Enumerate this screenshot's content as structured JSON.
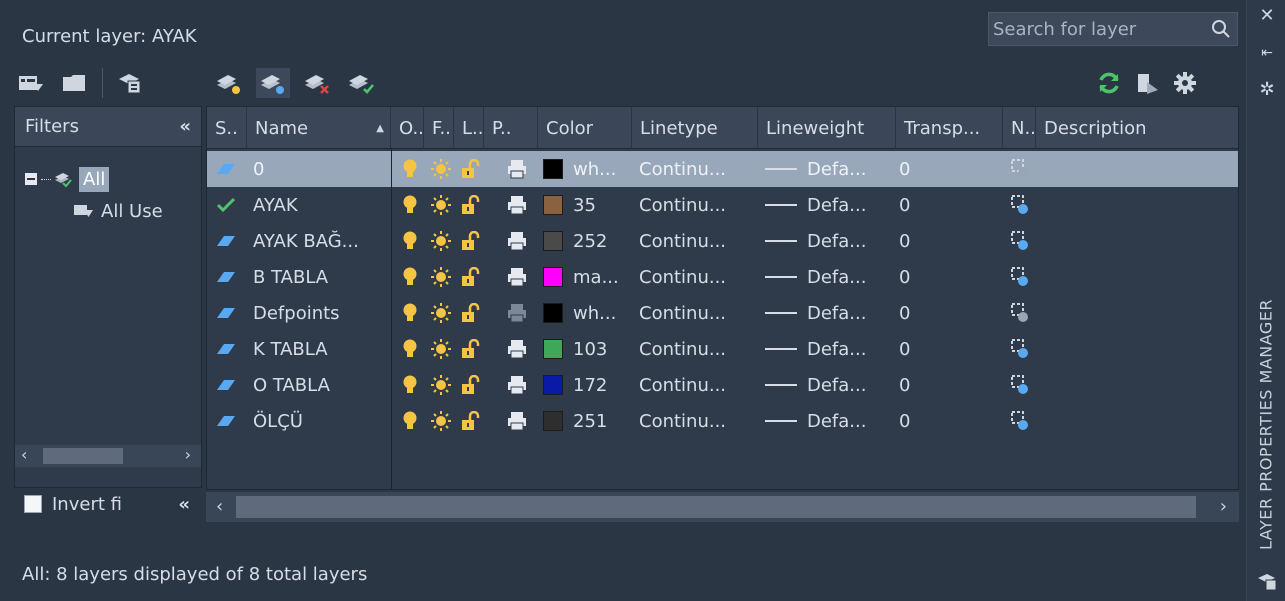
{
  "window": {
    "side_title": "LAYER PROPERTIES MANAGER"
  },
  "current_layer": "Current layer: AYAK",
  "search": {
    "placeholder": "Search for layer"
  },
  "filters": {
    "header": "Filters",
    "collapse": "«",
    "tree": [
      {
        "label": "All"
      },
      {
        "label": "All Use"
      }
    ],
    "invert_label": "Invert fi"
  },
  "columns": [
    "S..",
    "Name",
    "O..",
    "F..",
    "L..",
    "P..",
    "Color",
    "Linetype",
    "Lineweight",
    "Transp...",
    "N..",
    "Description"
  ],
  "layers": [
    {
      "status": "layer",
      "name": "0",
      "color_swatch": "#000000",
      "color_name": "wh...",
      "linetype": "Continu...",
      "lineweight": "Defa...",
      "transparency": "0",
      "plot_dim": false,
      "selected": true
    },
    {
      "status": "current",
      "name": "AYAK",
      "color_swatch": "#8a6240",
      "color_name": "35",
      "linetype": "Continu...",
      "lineweight": "Defa...",
      "transparency": "0",
      "plot_dim": false,
      "selected": false
    },
    {
      "status": "layer",
      "name": "AYAK BAĞ...",
      "color_swatch": "#4a4a4a",
      "color_name": "252",
      "linetype": "Continu...",
      "lineweight": "Defa...",
      "transparency": "0",
      "plot_dim": false,
      "selected": false
    },
    {
      "status": "layer",
      "name": "B TABLA",
      "color_swatch": "#ff00ff",
      "color_name": "ma...",
      "linetype": "Continu...",
      "lineweight": "Defa...",
      "transparency": "0",
      "plot_dim": false,
      "selected": false
    },
    {
      "status": "layer",
      "name": "Defpoints",
      "color_swatch": "#000000",
      "color_name": "wh...",
      "linetype": "Continu...",
      "lineweight": "Defa...",
      "transparency": "0",
      "plot_dim": true,
      "selected": false
    },
    {
      "status": "layer",
      "name": "K TABLA",
      "color_swatch": "#3fa75a",
      "color_name": "103",
      "linetype": "Continu...",
      "lineweight": "Defa...",
      "transparency": "0",
      "plot_dim": false,
      "selected": false
    },
    {
      "status": "layer",
      "name": "O TABLA",
      "color_swatch": "#0a1aa8",
      "color_name": "172",
      "linetype": "Continu...",
      "lineweight": "Defa...",
      "transparency": "0",
      "plot_dim": false,
      "selected": false
    },
    {
      "status": "layer",
      "name": "ÖLÇÜ",
      "color_swatch": "#2e2e2e",
      "color_name": "251",
      "linetype": "Continu...",
      "lineweight": "Defa...",
      "transparency": "0",
      "plot_dim": false,
      "selected": false
    }
  ],
  "status_bar": "All: 8 layers displayed of 8 total layers",
  "colors": {
    "accent_bulb": "#f5c542",
    "accent_check": "#4fc36a",
    "layer_icon": "#5aa9f0",
    "refresh": "#4fc36a"
  }
}
